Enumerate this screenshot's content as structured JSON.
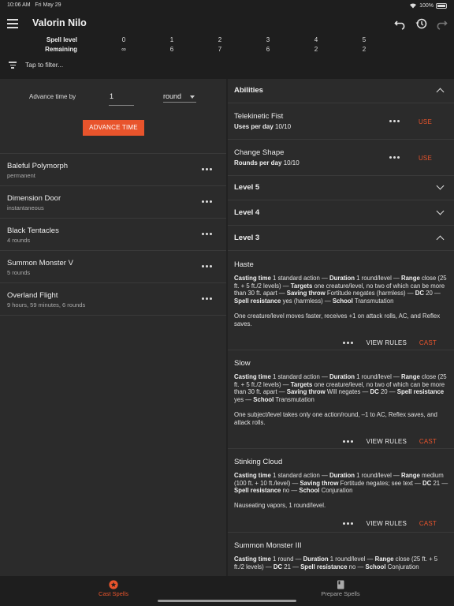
{
  "status": {
    "time": "10:06 AM",
    "date": "Fri May 29",
    "battery": "100%"
  },
  "header": {
    "title": "Valorin Nilo",
    "spell_level_label": "Spell level",
    "remaining_label": "Remaining",
    "levels": [
      "0",
      "1",
      "2",
      "3",
      "4",
      "5"
    ],
    "remaining": [
      "∞",
      "6",
      "7",
      "6",
      "2",
      "2"
    ],
    "filter_text": "Tap to filter..."
  },
  "advance": {
    "label": "Advance time by",
    "value": "1",
    "unit": "round",
    "button": "ADVANCE TIME"
  },
  "effects": [
    {
      "name": "Baleful Polymorph",
      "duration": "permanent"
    },
    {
      "name": "Dimension Door",
      "duration": "instantaneous"
    },
    {
      "name": "Black Tentacles",
      "duration": "4 rounds"
    },
    {
      "name": "Summon Monster V",
      "duration": "5 rounds"
    },
    {
      "name": "Overland Flight",
      "duration": "9 hours, 59 minutes, 6 rounds"
    }
  ],
  "abilities_section": {
    "title": "Abilities",
    "items": [
      {
        "name": "Telekinetic Fist",
        "usage_label": "Uses per day",
        "usage_value": "10/10",
        "action": "USE"
      },
      {
        "name": "Change Shape",
        "usage_label": "Rounds per day",
        "usage_value": "10/10",
        "action": "USE"
      }
    ]
  },
  "levels_sections": [
    {
      "title": "Level 5"
    },
    {
      "title": "Level 4"
    },
    {
      "title": "Level 3"
    }
  ],
  "labels": {
    "view_rules": "VIEW RULES",
    "cast": "CAST"
  },
  "spells": [
    {
      "name": "Haste",
      "casting_time": "1 standard action",
      "duration": "1 round/level",
      "range": "close (25 ft. + 5 ft./2 levels)",
      "targets": "one creature/level, no two of which can be more than 30 ft. apart",
      "saving_throw": "Fortitude negates (harmless)",
      "dc": "20",
      "spell_resistance": "yes (harmless)",
      "school": "Transmutation",
      "summary": "One creature/level moves faster, receives +1 on attack rolls, AC, and Reflex saves."
    },
    {
      "name": "Slow",
      "casting_time": "1 standard action",
      "duration": "1 round/level",
      "range": "close (25 ft. + 5 ft./2 levels)",
      "targets": "one creature/level, no two of which can be more than 30 ft. apart",
      "saving_throw": "Will negates",
      "dc": "20",
      "spell_resistance": "yes",
      "school": "Transmutation",
      "summary": "One subject/level takes only one action/round, –1 to AC, Reflex saves, and attack rolls."
    },
    {
      "name": "Stinking Cloud",
      "casting_time": "1 standard action",
      "duration": "1 round/level",
      "range": "medium (100 ft. + 10 ft./level)",
      "saving_throw": "Fortitude negates; see text",
      "dc": "21",
      "spell_resistance": "no",
      "school": "Conjuration",
      "summary": "Nauseating vapors, 1 round/level."
    },
    {
      "name": "Summon Monster III",
      "casting_time": "1 round",
      "duration": "1 round/level",
      "range": "close (25 ft. + 5 ft./2 levels)",
      "dc": "21",
      "spell_resistance": "no",
      "school": "Conjuration"
    }
  ],
  "field_labels": {
    "casting_time": "Casting time",
    "duration": "Duration",
    "range": "Range",
    "targets": "Targets",
    "saving_throw": "Saving throw",
    "dc": "DC",
    "spell_resistance": "Spell resistance",
    "school": "School",
    "sep": " — "
  },
  "nav": {
    "cast": "Cast Spells",
    "prepare": "Prepare Spells"
  },
  "colors": {
    "accent": "#e8542c",
    "background": "#2b2b2b",
    "bar": "#1e1e1e"
  },
  "icons": [
    "menu-icon",
    "undo-icon",
    "history-icon",
    "redo-icon",
    "filter-icon",
    "more-icon",
    "chevron-up-icon",
    "chevron-down-icon",
    "star-icon",
    "book-icon",
    "wifi-icon",
    "battery-icon"
  ]
}
